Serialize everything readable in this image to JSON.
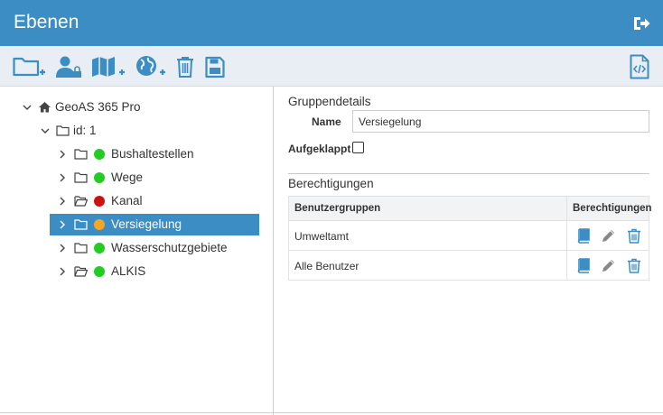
{
  "header": {
    "title": "Ebenen"
  },
  "toolbar": {
    "buttons": [
      {
        "icon": "folder-add-icon"
      },
      {
        "icon": "user-lock-icon"
      },
      {
        "icon": "map-add-icon"
      },
      {
        "icon": "globe-add-icon"
      },
      {
        "icon": "trash-icon"
      },
      {
        "icon": "save-icon"
      },
      {
        "icon": "code-file-icon"
      }
    ]
  },
  "tree": {
    "root": {
      "label": "GeoAS 365 Pro",
      "icon": "home-icon"
    },
    "group": {
      "label": "id: 1",
      "icon": "folder-icon"
    },
    "layers": [
      {
        "label": "Bushaltestellen",
        "status_color": "#22cc22",
        "folder": "closed"
      },
      {
        "label": "Wege",
        "status_color": "#22cc22",
        "folder": "closed"
      },
      {
        "label": "Kanal",
        "status_color": "#cc1111",
        "folder": "open"
      },
      {
        "label": "Versiegelung",
        "status_color": "#f5a623",
        "folder": "closed",
        "selected": true
      },
      {
        "label": "Wasserschutzgebiete",
        "status_color": "#22cc22",
        "folder": "closed"
      },
      {
        "label": "ALKIS",
        "status_color": "#22cc22",
        "folder": "open"
      }
    ]
  },
  "details": {
    "section_title": "Gruppendetails",
    "name_label": "Name",
    "name_value": "Versiegelung",
    "expanded_label": "Aufgeklappt"
  },
  "permissions": {
    "section_title": "Berechtigungen",
    "col_groups": "Benutzergruppen",
    "col_permissions": "Berechtigungen",
    "rows": [
      {
        "group": "Umweltamt"
      },
      {
        "group": "Alle Benutzer"
      }
    ]
  },
  "colors": {
    "accent": "#3b8dc3",
    "toolbar_bg": "#e9eef4",
    "status_green": "#22cc22",
    "status_red": "#cc1111",
    "status_orange": "#f5a623"
  }
}
